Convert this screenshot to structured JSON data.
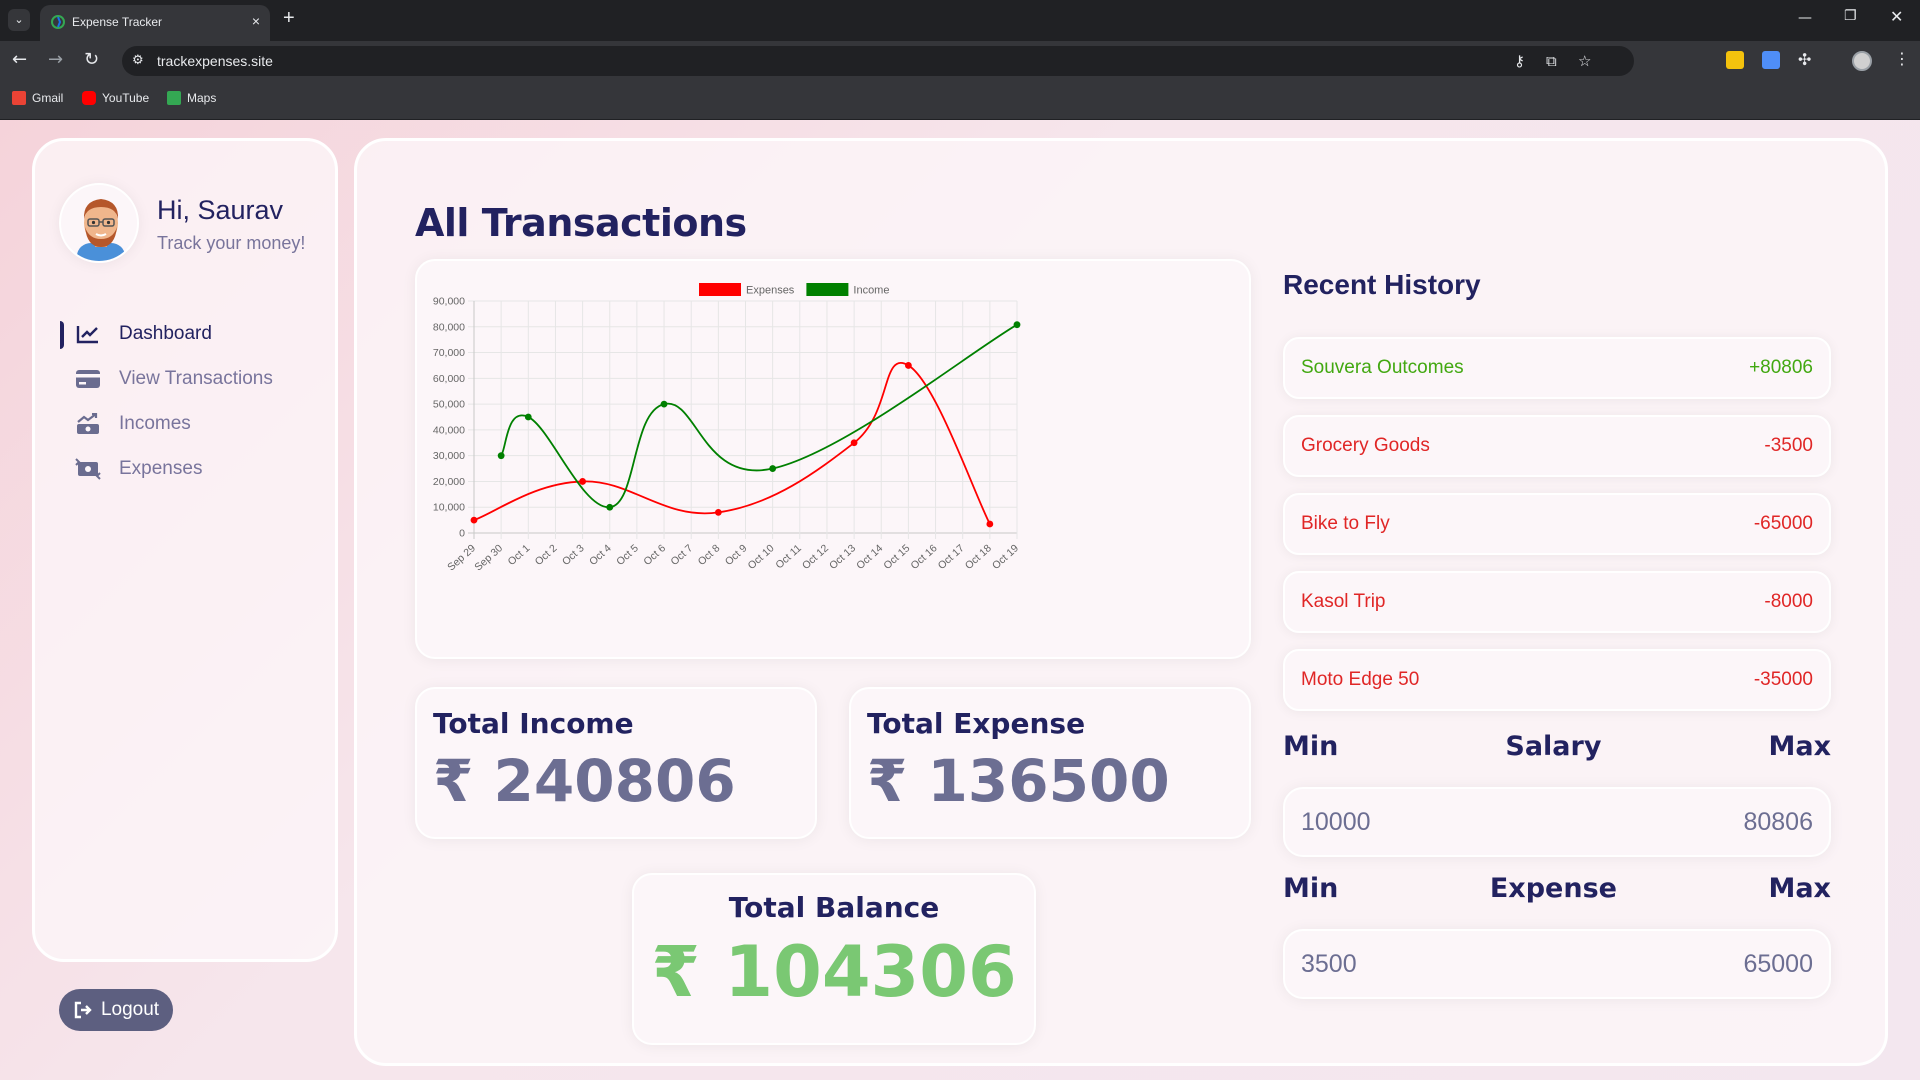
{
  "browser": {
    "tab_title": "Expense Tracker",
    "tab_close": "×",
    "new_tab": "+",
    "url": "trackexpenses.site",
    "bookmarks": [
      {
        "label": "Gmail",
        "color": "#ea4335"
      },
      {
        "label": "YouTube",
        "color": "#ff0000"
      },
      {
        "label": "Maps",
        "color": "#34a853"
      }
    ],
    "icons": {
      "back": "arrow-left-icon",
      "forward": "arrow-right-icon",
      "reload": "reload-icon",
      "minimize": "minimize-icon",
      "restore": "restore-icon",
      "close": "close-icon"
    }
  },
  "profile": {
    "greeting": "Hi, Saurav",
    "tagline": "Track your money!"
  },
  "menu": [
    {
      "label": "Dashboard",
      "icon": "chart-line-icon",
      "active": true
    },
    {
      "label": "View Transactions",
      "icon": "credit-card-icon",
      "active": false
    },
    {
      "label": "Incomes",
      "icon": "money-bill-trend-up-icon",
      "active": false
    },
    {
      "label": "Expenses",
      "icon": "money-bill-transfer-icon",
      "active": false
    }
  ],
  "logout_label": "Logout",
  "main_title": "All Transactions",
  "colors": {
    "navy": "#222260",
    "income_green": "#42a811",
    "expense_red": "#e02626",
    "balance_green": "#7ac873",
    "muted": "#6c6e92",
    "chart_red": "#ff0000",
    "chart_green": "#008000"
  },
  "chart_data": {
    "type": "line",
    "categories": [
      "Sep 29",
      "Sep 30",
      "Oct 1",
      "Oct 2",
      "Oct 3",
      "Oct 4",
      "Oct 5",
      "Oct 6",
      "Oct 7",
      "Oct 8",
      "Oct 9",
      "Oct 10",
      "Oct 11",
      "Oct 12",
      "Oct 13",
      "Oct 14",
      "Oct 15",
      "Oct 16",
      "Oct 17",
      "Oct 18",
      "Oct 19"
    ],
    "series": [
      {
        "name": "Expenses",
        "color": "#ff0000",
        "points": [
          {
            "x": 0,
            "y": 5000
          },
          {
            "x": 4,
            "y": 20000
          },
          {
            "x": 9,
            "y": 8000
          },
          {
            "x": 14,
            "y": 35000
          },
          {
            "x": 16,
            "y": 65000
          },
          {
            "x": 19,
            "y": 3500
          }
        ]
      },
      {
        "name": "Income",
        "color": "#008000",
        "points": [
          {
            "x": 1,
            "y": 30000
          },
          {
            "x": 2,
            "y": 45000
          },
          {
            "x": 5,
            "y": 10000
          },
          {
            "x": 7,
            "y": 50000
          },
          {
            "x": 11,
            "y": 25000
          },
          {
            "x": 20,
            "y": 80806
          }
        ]
      }
    ],
    "ylim": [
      0,
      90000
    ],
    "yticks": [
      "0",
      "10,000",
      "20,000",
      "30,000",
      "40,000",
      "50,000",
      "60,000",
      "70,000",
      "80,000",
      "90,000"
    ],
    "legend_position": "top-center",
    "grid": true
  },
  "totals": {
    "income_label": "Total Income",
    "income_value": "₹ 240806",
    "expense_label": "Total Expense",
    "expense_value": "₹ 136500",
    "balance_label": "Total Balance",
    "balance_value": "₹ 104306"
  },
  "history": {
    "title": "Recent History",
    "items": [
      {
        "title": "Souvera Outcomes",
        "amount": "+80806",
        "kind": "income"
      },
      {
        "title": "Grocery Goods",
        "amount": "-3500",
        "kind": "expense"
      },
      {
        "title": "Bike to Fly",
        "amount": "-65000",
        "kind": "expense"
      },
      {
        "title": "Kasol Trip",
        "amount": "-8000",
        "kind": "expense"
      },
      {
        "title": "Moto Edge 50",
        "amount": "-35000",
        "kind": "expense"
      }
    ]
  },
  "salary": {
    "min_label": "Min",
    "title": "Salary",
    "max_label": "Max",
    "min": "10000",
    "max": "80806"
  },
  "expense_range": {
    "min_label": "Min",
    "title": "Expense",
    "max_label": "Max",
    "min": "3500",
    "max": "65000"
  }
}
